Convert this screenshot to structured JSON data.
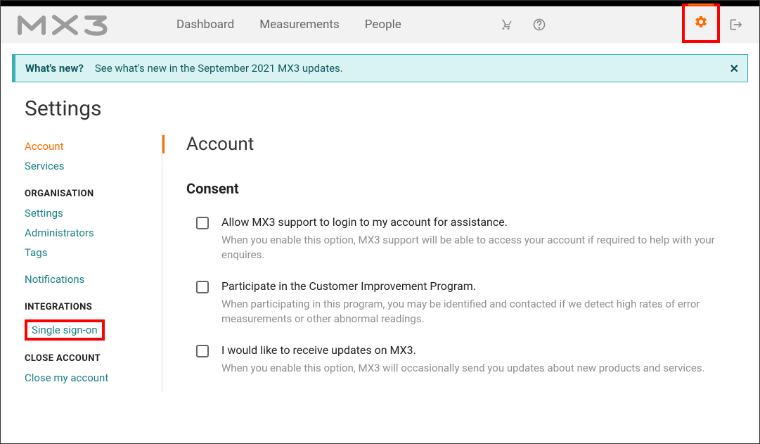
{
  "nav": {
    "dashboard": "Dashboard",
    "measurements": "Measurements",
    "people": "People"
  },
  "banner": {
    "title": "What's new?",
    "text": "See what's new in the September 2021 MX3 updates."
  },
  "page_title": "Settings",
  "sidebar": {
    "account": "Account",
    "services": "Services",
    "h_org": "ORGANISATION",
    "settings": "Settings",
    "admins": "Administrators",
    "tags": "Tags",
    "notifications": "Notifications",
    "h_int": "INTEGRATIONS",
    "sso": "Single sign-on",
    "h_close": "CLOSE ACCOUNT",
    "close": "Close my account"
  },
  "content": {
    "title": "Account",
    "section": "Consent",
    "opts": [
      {
        "title": "Allow MX3 support to login to my account for assistance.",
        "desc": "When you enable this option, MX3 support will be able to access your account if required to help with your enquires."
      },
      {
        "title": "Participate in the Customer Improvement Program.",
        "desc": "When participating in this program, you may be identified and contacted if we detect high rates of error measurements or other abnormal readings."
      },
      {
        "title": "I would like to receive updates on MX3.",
        "desc": "When you enable this option, MX3 will occasionally send you updates about new products and services."
      }
    ]
  }
}
